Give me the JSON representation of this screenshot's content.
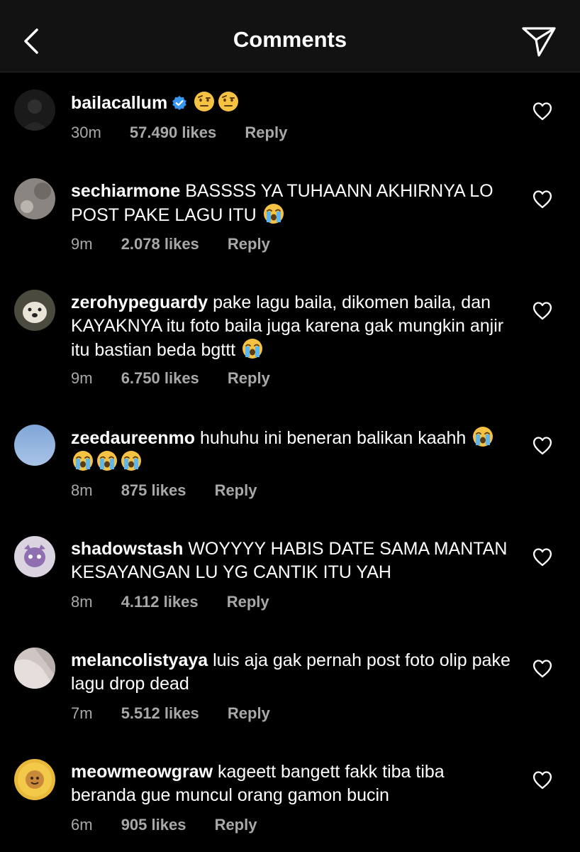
{
  "header": {
    "title": "Comments",
    "back_icon": "chevron-left-icon",
    "share_icon": "paper-plane-icon"
  },
  "colors": {
    "background": "#000000",
    "header_background": "#121212",
    "text": "#ffffff",
    "meta_text": "#a8a8a8",
    "verified": "#3897f0"
  },
  "comments": [
    {
      "username": "bailacallum",
      "verified": true,
      "text": "",
      "emojis": [
        "face-with-raised-eyebrow",
        "face-with-raised-eyebrow"
      ],
      "time": "30m",
      "likes": "57.490 likes",
      "reply": "Reply"
    },
    {
      "username": "sechiarmone",
      "text": "BASSSS YA TUHAANN AKHIRNYA LO POST PAKE LAGU ITU",
      "emojis": [
        "loudly-crying-face"
      ],
      "time": "9m",
      "likes": "2.078 likes",
      "reply": "Reply"
    },
    {
      "username": "zerohypeguardy",
      "text": "pake lagu baila, dikomen baila, dan KAYAKNYA itu foto baila juga karena gak mungkin anjir itu bastian beda bgttt",
      "emojis": [
        "loudly-crying-face"
      ],
      "time": "9m",
      "likes": "6.750 likes",
      "reply": "Reply"
    },
    {
      "username": "zeedaureenmo",
      "text": "huhuhu ini beneran balikan kaahh",
      "emojis": [
        "loudly-crying-face",
        "loudly-crying-face",
        "loudly-crying-face",
        "loudly-crying-face"
      ],
      "time": "8m",
      "likes": "875 likes",
      "reply": "Reply"
    },
    {
      "username": "shadowstash",
      "text": "WOYYYY HABIS DATE SAMA MANTAN KESAYANGAN LU YG CANTIK ITU YAH",
      "emojis": [],
      "time": "8m",
      "likes": "4.112 likes",
      "reply": "Reply"
    },
    {
      "username": "melancolistyaya",
      "text": "luis aja gak pernah post foto olip pake lagu drop dead",
      "emojis": [],
      "time": "7m",
      "likes": "5.512 likes",
      "reply": "Reply"
    },
    {
      "username": "meowmeowgraw",
      "text": "kageett bangett fakk tiba tiba beranda gue muncul orang gamon bucin",
      "emojis": [],
      "time": "6m",
      "likes": "905 likes",
      "reply": "Reply"
    }
  ]
}
